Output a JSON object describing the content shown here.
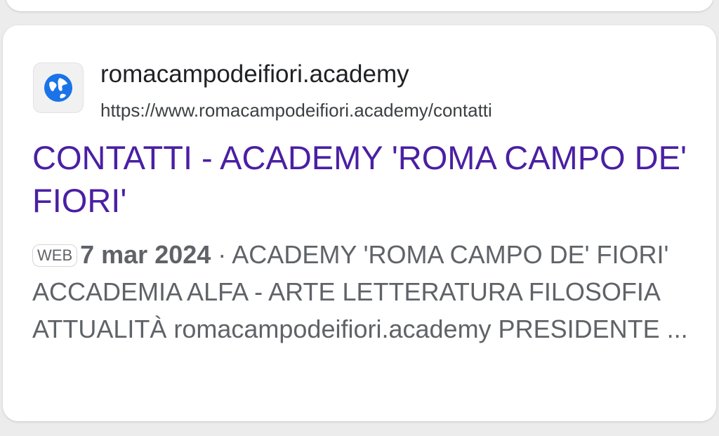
{
  "result": {
    "favicon_icon": "globe-icon",
    "site_name": "romacampodeifiori.academy",
    "url": "https://www.romacampodeifiori.academy/contatti",
    "title": "CONTATTI - ACADEMY 'ROMA CAMPO DE' FIORI'",
    "badge": "WEB",
    "date": "7 mar 2024",
    "separator": " · ",
    "snippet": "ACADEMY 'ROMA CAMPO DE' FIORI' ACCADEMIA ALFA - ARTE LETTERATURA FILOSOFIA ATTUALITÀ romacampodeifiori.academy PRESIDENTE ...",
    "colors": {
      "title": "#4a1fa3",
      "globe": "#1a73e8"
    }
  }
}
